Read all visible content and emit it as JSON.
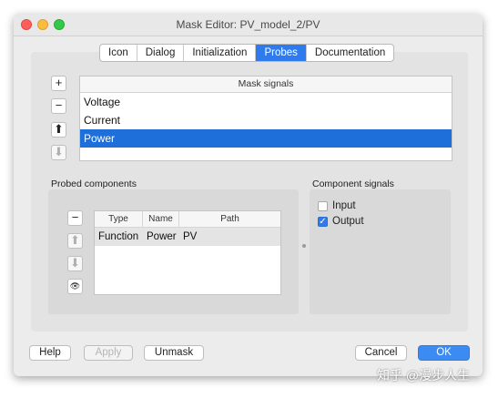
{
  "window": {
    "title": "Mask Editor: PV_model_2/PV"
  },
  "tabs": [
    "Icon",
    "Dialog",
    "Initialization",
    "Probes",
    "Documentation"
  ],
  "mask_signals": {
    "header": "Mask signals",
    "buttons": {
      "add": "+",
      "remove": "−",
      "up": "⬆",
      "down": "⬇"
    },
    "rows": [
      "Voltage",
      "Current",
      "Power"
    ]
  },
  "probed_components": {
    "label": "Probed components",
    "columns": [
      "Type",
      "Name",
      "Path"
    ],
    "rows": [
      {
        "type": "Function",
        "name": "Power",
        "path": "PV"
      }
    ],
    "buttons": {
      "remove": "−",
      "up": "⬆",
      "down": "⬇",
      "view": "👁"
    }
  },
  "component_signals": {
    "label": "Component signals",
    "items": [
      {
        "label": "Input",
        "checked": false
      },
      {
        "label": "Output",
        "checked": true
      }
    ]
  },
  "footer": {
    "help": "Help",
    "apply": "Apply",
    "unmask": "Unmask",
    "cancel": "Cancel",
    "ok": "OK"
  },
  "watermark": "知乎 @漫步人生",
  "colors": {
    "accent": "#2f7bed",
    "selection": "#1e6fd9"
  }
}
